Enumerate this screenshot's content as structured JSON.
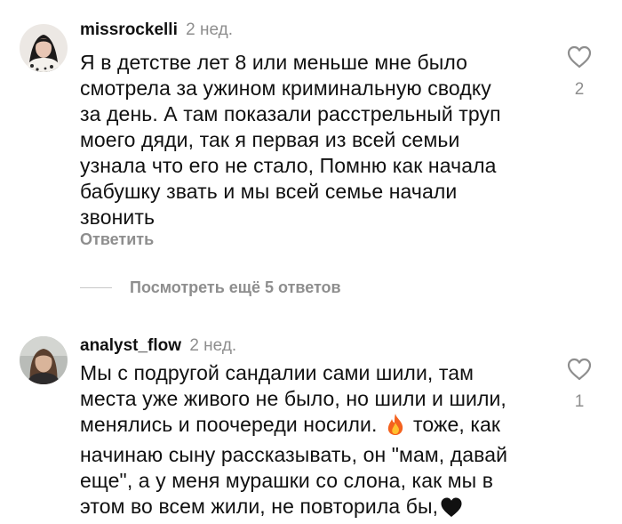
{
  "comments": [
    {
      "username": "missrockelli",
      "time": "2 нед.",
      "lines": [
        "Я в детстве лет 8 или меньше мне было",
        "смотрела за ужином криминальную сводку",
        "за день. А там показали расстрельный труп",
        "моего дяди, так я первая из всей семьи",
        "узнала что его не стало, Помню как начала",
        "бабушку звать  и мы всей семье начали",
        "звонить"
      ],
      "likes": "2",
      "reply_label": "Ответить",
      "view_replies_label": "Посмотреть ещё 5 ответов",
      "like_icon": "heart-outline-icon"
    },
    {
      "username": "analyst_flow",
      "time": "2 нед.",
      "lines": [
        "Мы с подругой сандалии сами шили, там",
        "места уже живого не было, но шили и шили,",
        "менялись и поочереди носили.",
        " тоже, как",
        "начинаю сыну рассказывать, он \"мам, давай",
        "еще\", а у меня мурашки со слона, как мы в",
        "этом во всем жили, не повторила бы,"
      ],
      "likes": "1",
      "like_icon": "heart-outline-icon",
      "inline_emojis": [
        "fire-emoji",
        "black-heart-emoji"
      ]
    }
  ],
  "colors": {
    "text": "#111111",
    "secondary": "#8e8e8e",
    "divider": "#c7c7c7"
  }
}
